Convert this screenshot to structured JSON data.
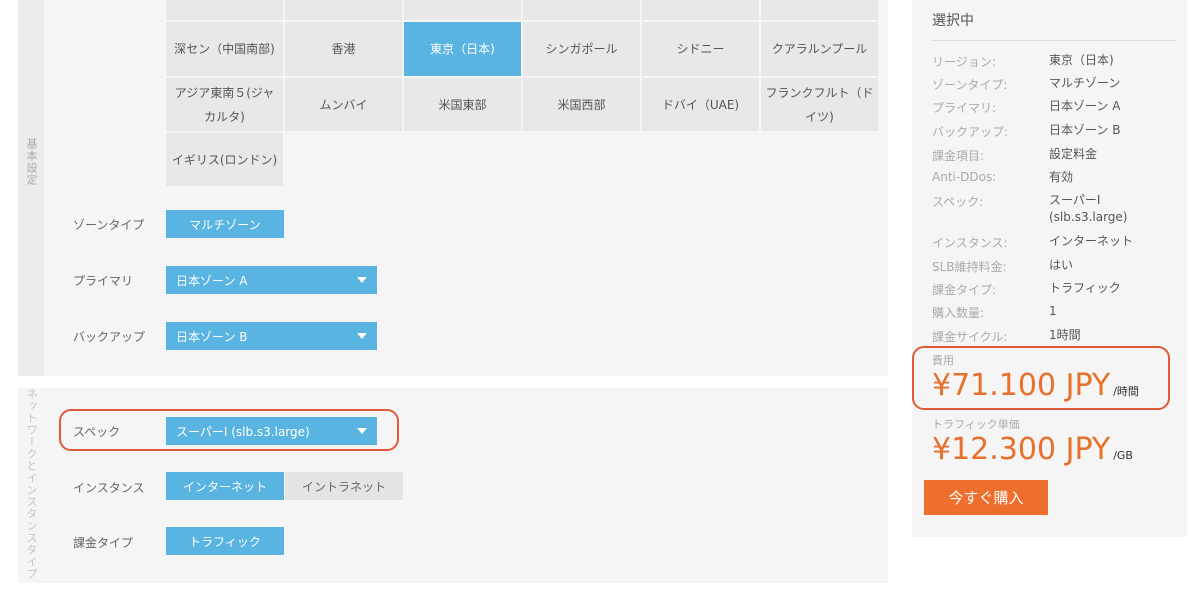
{
  "sections": {
    "basic": "基本設定",
    "network": "ネットワークとインスタンスタイプ"
  },
  "regions": {
    "row1": [
      "深セン（中国南部)",
      "香港",
      "東京（日本)",
      "シンガポール",
      "シドニー",
      "クアラルンプール"
    ],
    "row2": [
      "アジア東南５(ジャカルタ)",
      "ムンバイ",
      "米国東部",
      "米国西部",
      "ドバイ（UAE)",
      "フランクフルト（ドイツ)"
    ],
    "row3": [
      "イギリス(ロンドン)"
    ],
    "selected": "東京（日本)"
  },
  "zone_type": {
    "label": "ゾーンタイプ",
    "value": "マルチゾーン"
  },
  "primary": {
    "label": "プライマリ",
    "value": "日本ゾーン A"
  },
  "backup": {
    "label": "バックアップ",
    "value": "日本ゾーン B"
  },
  "spec": {
    "label": "スペック",
    "value": "スーパーI (slb.s3.large)"
  },
  "instance": {
    "label": "インスタンス",
    "options": [
      "インターネット",
      "イントラネット"
    ],
    "selected": "インターネット"
  },
  "billing_type": {
    "label": "課金タイプ",
    "value": "トラフィック"
  },
  "summary": {
    "title": "選択中",
    "rows": [
      {
        "key": "リージョン:",
        "value": "東京（日本)"
      },
      {
        "key": "ゾーンタイプ:",
        "value": "マルチゾーン"
      },
      {
        "key": "プライマリ:",
        "value": "日本ゾーン A"
      },
      {
        "key": "バックアップ:",
        "value": "日本ゾーン B"
      },
      {
        "key": "課金項目:",
        "value": "設定料金"
      },
      {
        "key": "Anti-DDos:",
        "value": "有効"
      },
      {
        "key": "スペック:",
        "value": "スーパーI (slb.s3.large)"
      },
      {
        "key": "インスタンス:",
        "value": "インターネット"
      },
      {
        "key": "SLB維持料金:",
        "value": "はい"
      },
      {
        "key": "課金タイプ:",
        "value": "トラフィック"
      },
      {
        "key": "購入数量:",
        "value": "1"
      },
      {
        "key": "課金サイクル:",
        "value": "1時間"
      }
    ],
    "fee_label": "費用",
    "fee_price": "¥71.100 JPY",
    "fee_unit": "/時間",
    "unit_price_label": "トラフィック単価",
    "unit_price": "¥12.300 JPY",
    "unit_price_unit": "/GB",
    "buy_label": "今すぐ購入"
  },
  "colors": {
    "accent_blue": "#5ab4e1",
    "price_orange": "#e8702a",
    "buy_button": "#ee6f2d",
    "highlight": "#e05a3a"
  }
}
